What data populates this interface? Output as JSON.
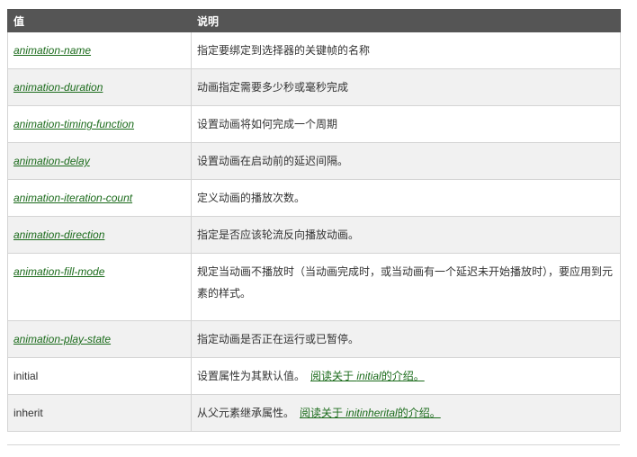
{
  "table": {
    "header": {
      "col1": "值",
      "col2": "说明"
    },
    "rows": [
      {
        "value": "animation-name",
        "desc": "指定要绑定到选择器的关键帧的名称"
      },
      {
        "value": "animation-duration",
        "desc": "动画指定需要多少秒或毫秒完成"
      },
      {
        "value": "animation-timing-function",
        "desc": "设置动画将如何完成一个周期"
      },
      {
        "value": "animation-delay",
        "desc": "设置动画在启动前的延迟间隔。"
      },
      {
        "value": "animation-iteration-count",
        "desc": "定义动画的播放次数。"
      },
      {
        "value": "animation-direction",
        "desc": "指定是否应该轮流反向播放动画。"
      },
      {
        "value": "animation-fill-mode",
        "desc": "规定当动画不播放时（当动画完成时，或当动画有一个延迟未开始播放时），要应用到元素的样式。"
      },
      {
        "value": "animation-play-state",
        "desc": "指定动画是否正在运行或已暂停。"
      },
      {
        "value": "initial",
        "desc": "设置属性为其默认值。",
        "link_prefix": "阅读关于 ",
        "link_word": "initial",
        "link_suffix": "的介绍。"
      },
      {
        "value": "inherit",
        "desc": "从父元素继承属性。",
        "link_prefix": "阅读关于 ",
        "link_word": "initinherital",
        "link_suffix": "的介绍。"
      }
    ]
  }
}
